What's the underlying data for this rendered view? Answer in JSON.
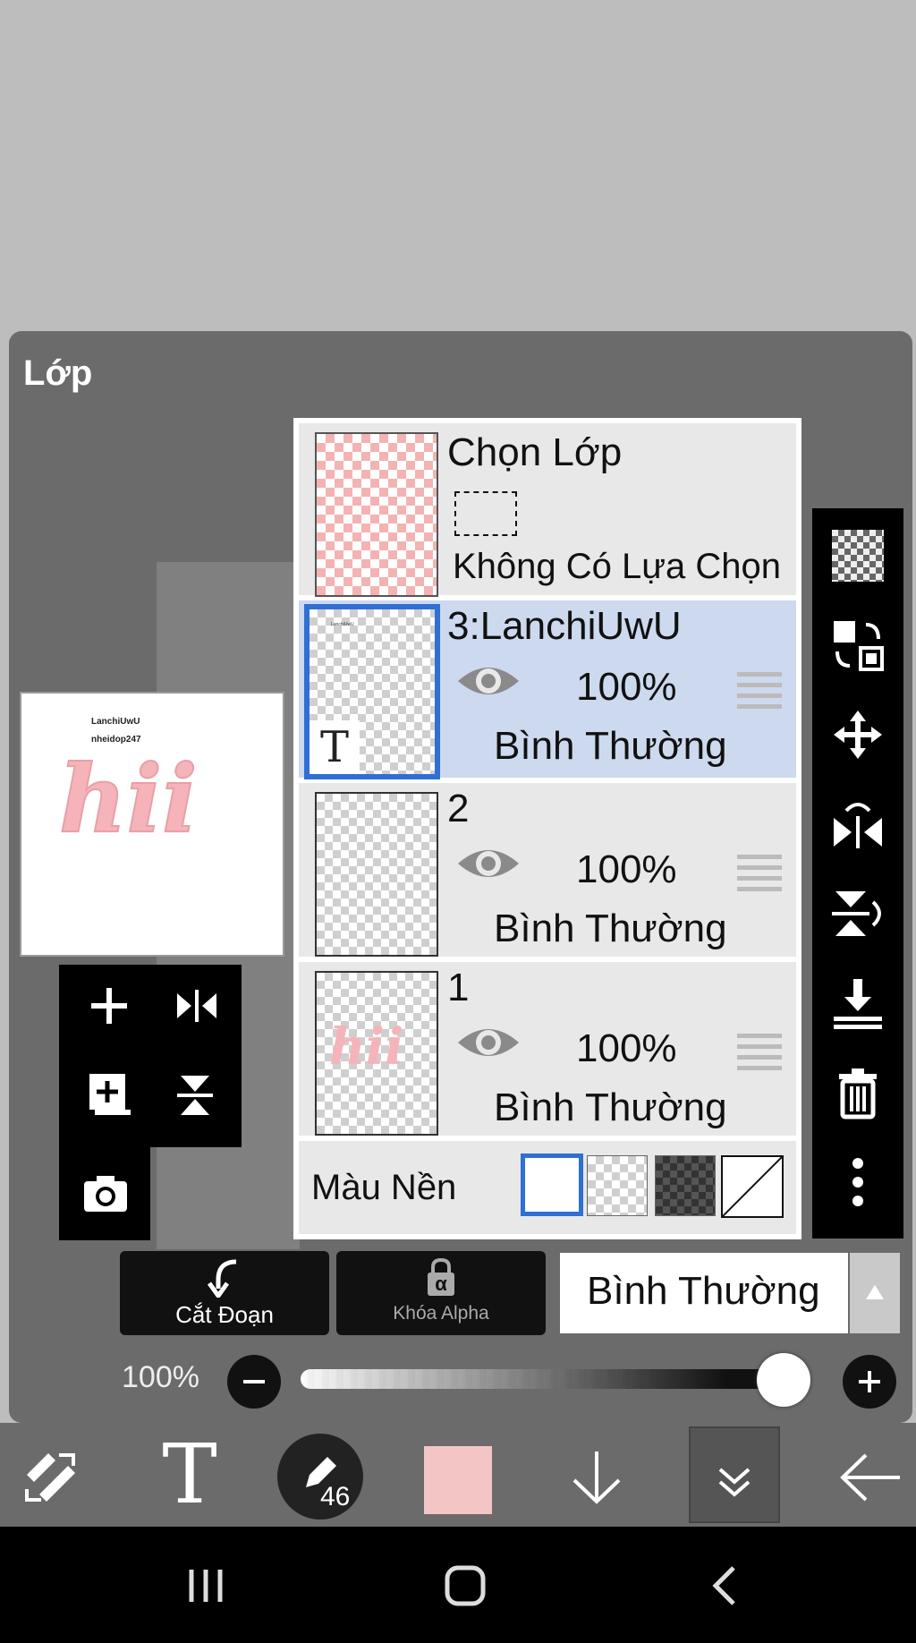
{
  "panel": {
    "title": "Lớp"
  },
  "selection_row": {
    "title": "Chọn Lớp",
    "status": "Không Có Lựa Chọn"
  },
  "layers": [
    {
      "name": "3:LanchiUwU",
      "opacity": "100%",
      "blend": "Bình Thường",
      "selected": true,
      "type_badge": "T"
    },
    {
      "name": "2",
      "opacity": "100%",
      "blend": "Bình Thường",
      "selected": false
    },
    {
      "name": "1",
      "opacity": "100%",
      "blend": "Bình Thường",
      "selected": false
    }
  ],
  "background_row": {
    "label": "Màu Nền"
  },
  "preview": {
    "line1": "LanchiUwU",
    "line2": "nheidop247",
    "art_text": "hii"
  },
  "controls": {
    "clip_label": "Cắt Đoạn",
    "alpha_lock_label": "Khóa Alpha",
    "alpha_lock_glyph": "α",
    "blend_mode": "Bình Thường",
    "opacity_label": "100%",
    "opacity_value": 1.0
  },
  "toolbar": {
    "brush_size": "46",
    "text_glyph": "T",
    "current_color": "#f4c5c5"
  },
  "colors": {
    "selected_border": "#2f6fd6",
    "selected_row": "#ccd9ee",
    "panel_bg": "#6b6b6b"
  },
  "icons": {
    "right_bar": [
      "checker-icon",
      "copy-layer-icon",
      "move-icon",
      "flip-horizontal-icon",
      "flip-vertical-icon",
      "merge-down-icon",
      "trash-icon",
      "more-icon"
    ],
    "left_tools": [
      "add-layer-icon",
      "flip-h-small-icon",
      "add-copy-icon",
      "flip-v-small-icon",
      "camera-icon"
    ]
  }
}
